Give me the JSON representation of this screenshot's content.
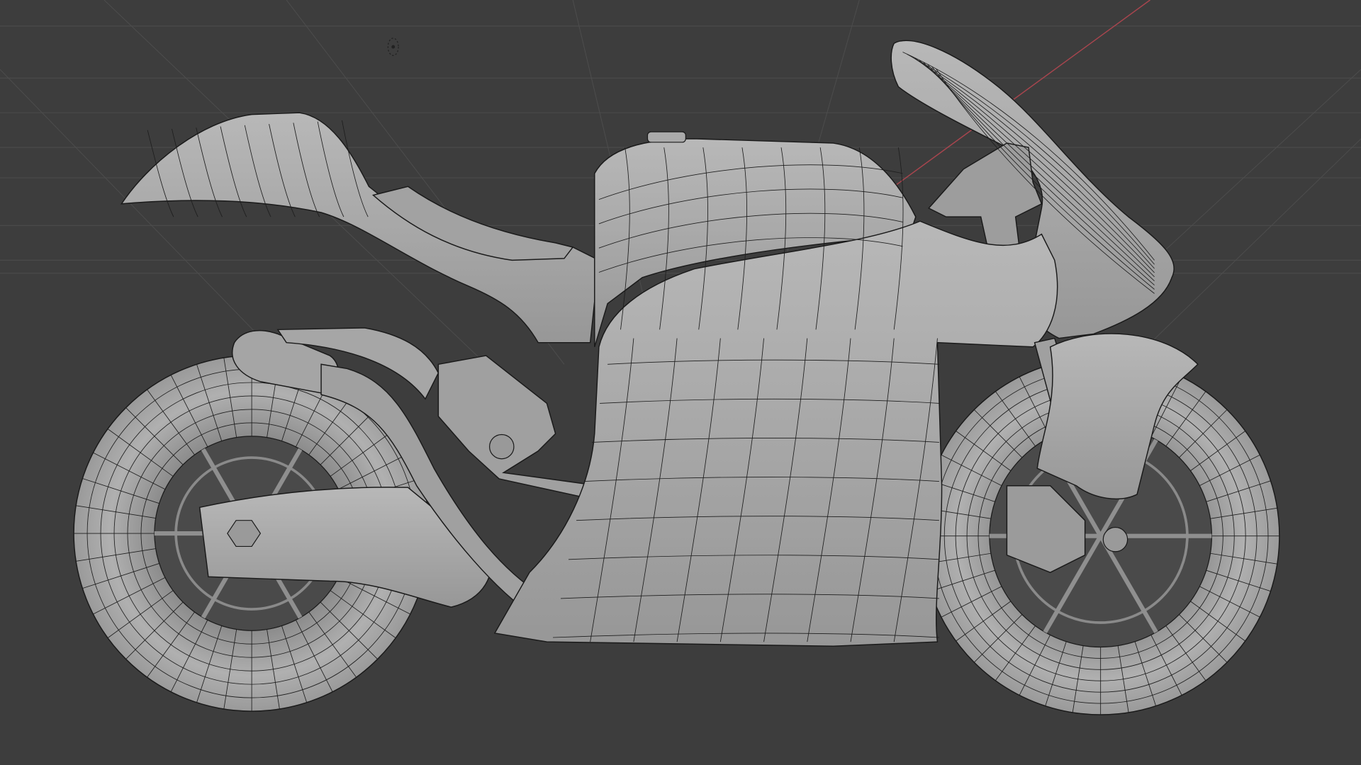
{
  "viewport": {
    "background": "#3d3d3d",
    "grid_color": "#4a4a4a",
    "x_axis_color": "#a8454e",
    "mesh_color": "#a9a9a9",
    "wire_color": "#1e1e1e"
  }
}
